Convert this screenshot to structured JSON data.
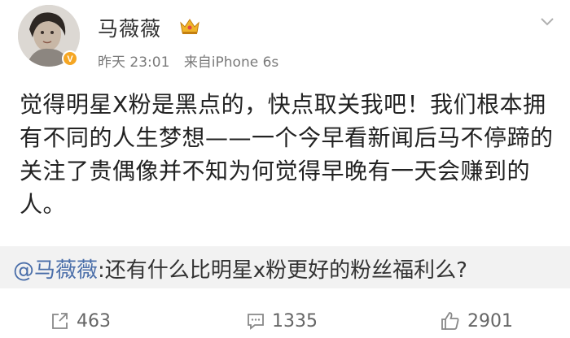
{
  "post": {
    "username": "马薇薇",
    "time": "昨天 23:01",
    "source": "来自iPhone 6s",
    "body": "觉得明星X粉是黑点的，快点取关我吧！我们根本拥有不同的人生梦想——一个今早看新闻后马不停蹄的关注了贵偶像并不知为何觉得早晚有一天会赚到的人。"
  },
  "repost": {
    "mention": "@马薇薇",
    "text": ":还有什么比明星x粉更好的粉丝福利么?"
  },
  "actions": {
    "repost_count": "463",
    "comment_count": "1335",
    "like_count": "2901"
  },
  "colors": {
    "mention": "#4a6ea9",
    "verified_badge": "#f5a623",
    "repost_bg": "#f2f2f2"
  },
  "icons": {
    "avatar": "avatar",
    "verified": "verified-badge-icon",
    "crown": "crown-icon",
    "menu": "chevron-down-icon",
    "repost": "repost-icon",
    "comment": "comment-icon",
    "like": "thumbs-up-icon"
  }
}
